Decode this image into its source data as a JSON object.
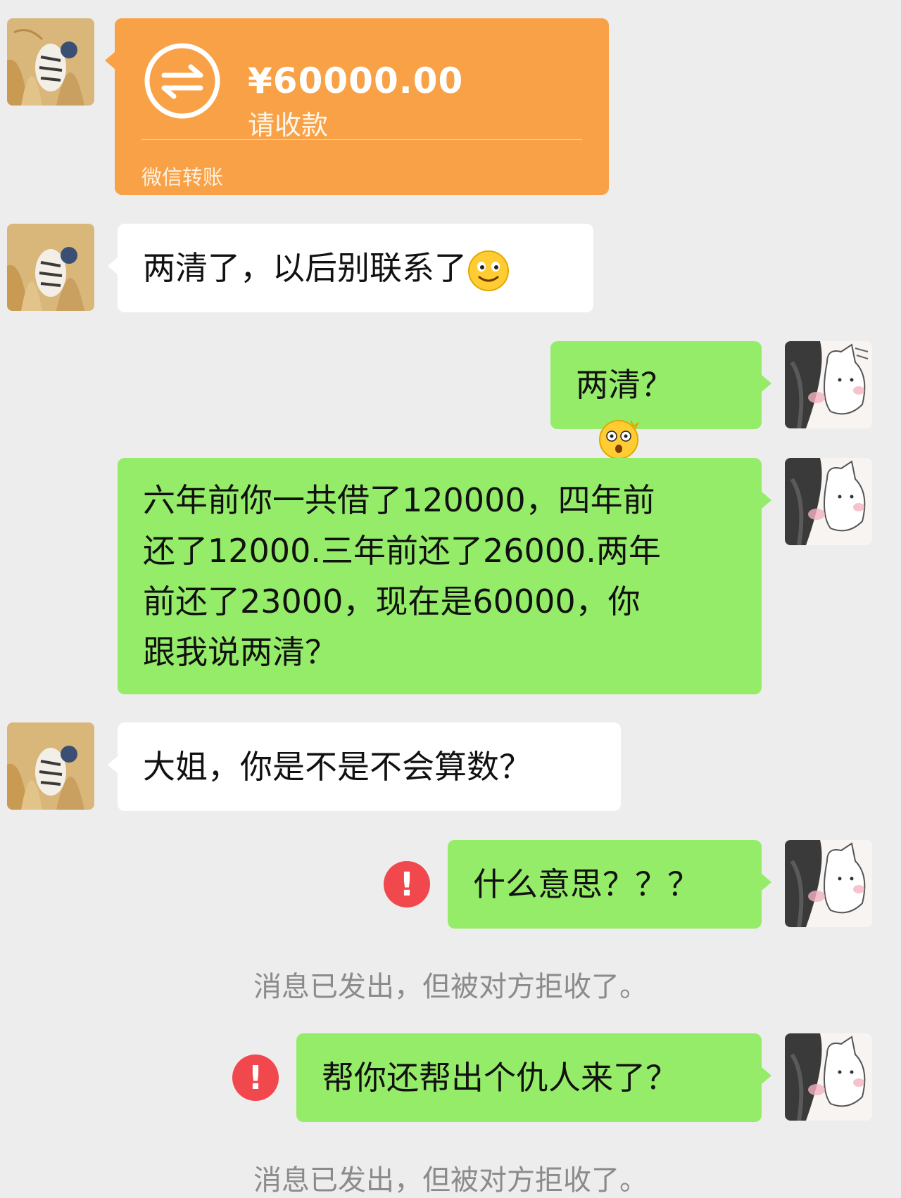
{
  "transfer": {
    "amount": "¥60000.00",
    "status": "请收款",
    "source": "微信转账",
    "icon": "transfer-arrows-icon",
    "color": "#f9a146"
  },
  "messages": [
    {
      "sender": "friend",
      "lines": [
        "两清了，以后别联系了"
      ],
      "emoji": "smile-emoji"
    },
    {
      "sender": "me",
      "lines": [
        "两清？"
      ],
      "emoji": "shocked-emoji"
    },
    {
      "sender": "me",
      "lines": [
        "六年前你一共借了120000，四年前",
        "还了12000.三年前还了26000.两年",
        "前还了23000，现在是60000，你",
        "跟我说两清？"
      ]
    },
    {
      "sender": "friend",
      "lines": [
        "大姐，你是不是不会算数？"
      ]
    },
    {
      "sender": "me",
      "lines": [
        "什么意思？？？"
      ],
      "failed": true,
      "error_mark": "!"
    },
    {
      "sender": "me",
      "lines": [
        "帮你还帮出个仇人来了？"
      ],
      "failed": true,
      "error_mark": "!"
    }
  ],
  "system_notes": [
    "消息已发出，但被对方拒收了。",
    "消息已发出，但被对方拒收了。"
  ],
  "colors": {
    "background": "#ededed",
    "my_bubble": "#95ec69",
    "friend_bubble": "#ffffff",
    "error": "#f0484d",
    "note_text": "#8b8b8b"
  }
}
